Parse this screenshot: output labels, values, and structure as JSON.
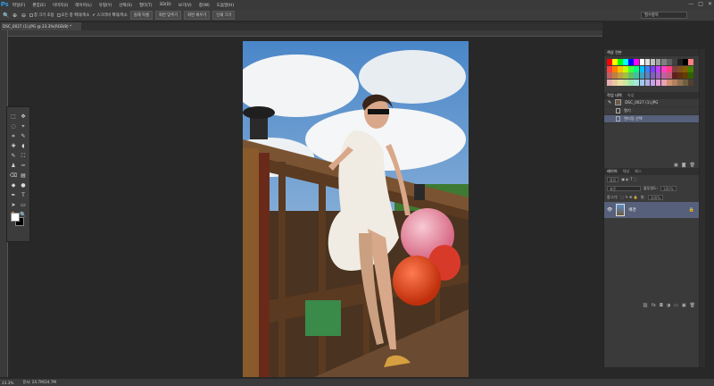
{
  "app": {
    "logo": "Ps"
  },
  "menu": [
    "파일(F)",
    "편집(E)",
    "이미지(I)",
    "레이어(L)",
    "유형(Y)",
    "선택(S)",
    "필터(T)",
    "3D(D)",
    "보기(V)",
    "창(W)",
    "도움말(H)"
  ],
  "window_controls": [
    "—",
    "□",
    "✕"
  ],
  "options": {
    "resize_windows": "창 크기 조정",
    "all_windows": "모든 창 확대/축소",
    "scrubby_zoom": "스크러비 확대/축소",
    "actual_pixels": "실제 픽셀",
    "fit_screen": "화면 맞추기",
    "fill_screen": "화면 채우기",
    "print_size": "인쇄 크기",
    "workspace": "필수항목"
  },
  "document": {
    "tab_label": "DSC_0027 (1).JPG @ 23.3%(RGB/8) *"
  },
  "tools": [
    "⬚",
    "✥",
    "◌",
    "⌖",
    "⌗",
    "✎",
    "✚",
    "◖",
    "✎",
    "⛶",
    "♟",
    "✑",
    "⌫",
    "▤",
    "◆",
    "●",
    "✒",
    "T",
    "➤",
    "▭",
    "✋",
    "🔍"
  ],
  "colors": {
    "foreground": "#ffffff",
    "background": "#000000",
    "accent": "#31a8ff",
    "selection": "#56607a"
  },
  "swatches_panel": {
    "tabs": [
      "색상 견본"
    ],
    "colors": [
      "#ff0000",
      "#ffff00",
      "#00ff00",
      "#00ffff",
      "#0000ff",
      "#ff00ff",
      "#ffffff",
      "#e0e0e0",
      "#c0c0c0",
      "#a0a0a0",
      "#808080",
      "#606060",
      "#404040",
      "#202020",
      "#000000",
      "#ff8080",
      "#ff4040",
      "#ff8000",
      "#ffc000",
      "#c0ff00",
      "#40ff40",
      "#00ff80",
      "#00c0ff",
      "#4080ff",
      "#8040ff",
      "#c040ff",
      "#ff40c0",
      "#ff4080",
      "#804040",
      "#805020",
      "#806000",
      "#408000",
      "#c06060",
      "#c08040",
      "#c0a040",
      "#a0c040",
      "#60c060",
      "#40c0a0",
      "#40a0c0",
      "#6080c0",
      "#8060c0",
      "#a060c0",
      "#c060a0",
      "#c06080",
      "#602020",
      "#603010",
      "#604000",
      "#306000",
      "#e8b0b0",
      "#e8c8a0",
      "#e8e0a0",
      "#c8e8a0",
      "#a0e8b0",
      "#a0e8e0",
      "#a0c8e8",
      "#b0b0e8",
      "#c8a0e8",
      "#e8a0d8",
      "#e8a0b8",
      "#d09070",
      "#b08060",
      "#907050",
      "#706040",
      "#504030"
    ]
  },
  "history_panel": {
    "tabs": [
      "작업 내역",
      "속성"
    ],
    "items": [
      "DSC_0027 (1).JPG",
      "열기",
      "렌더링 선택"
    ]
  },
  "layers_panel": {
    "tabs": [
      "레이어",
      "채널",
      "패스"
    ],
    "kind": "종류",
    "blend_mode": "표준",
    "opacity_label": "불투명도:",
    "opacity_value": "100%",
    "lock_label": "잠그기:",
    "fill_label": "칠:",
    "fill_value": "100%",
    "layers": [
      "배경"
    ]
  },
  "status": {
    "zoom": "23.3%",
    "doc": "문서: 24.7M/24.7M"
  }
}
